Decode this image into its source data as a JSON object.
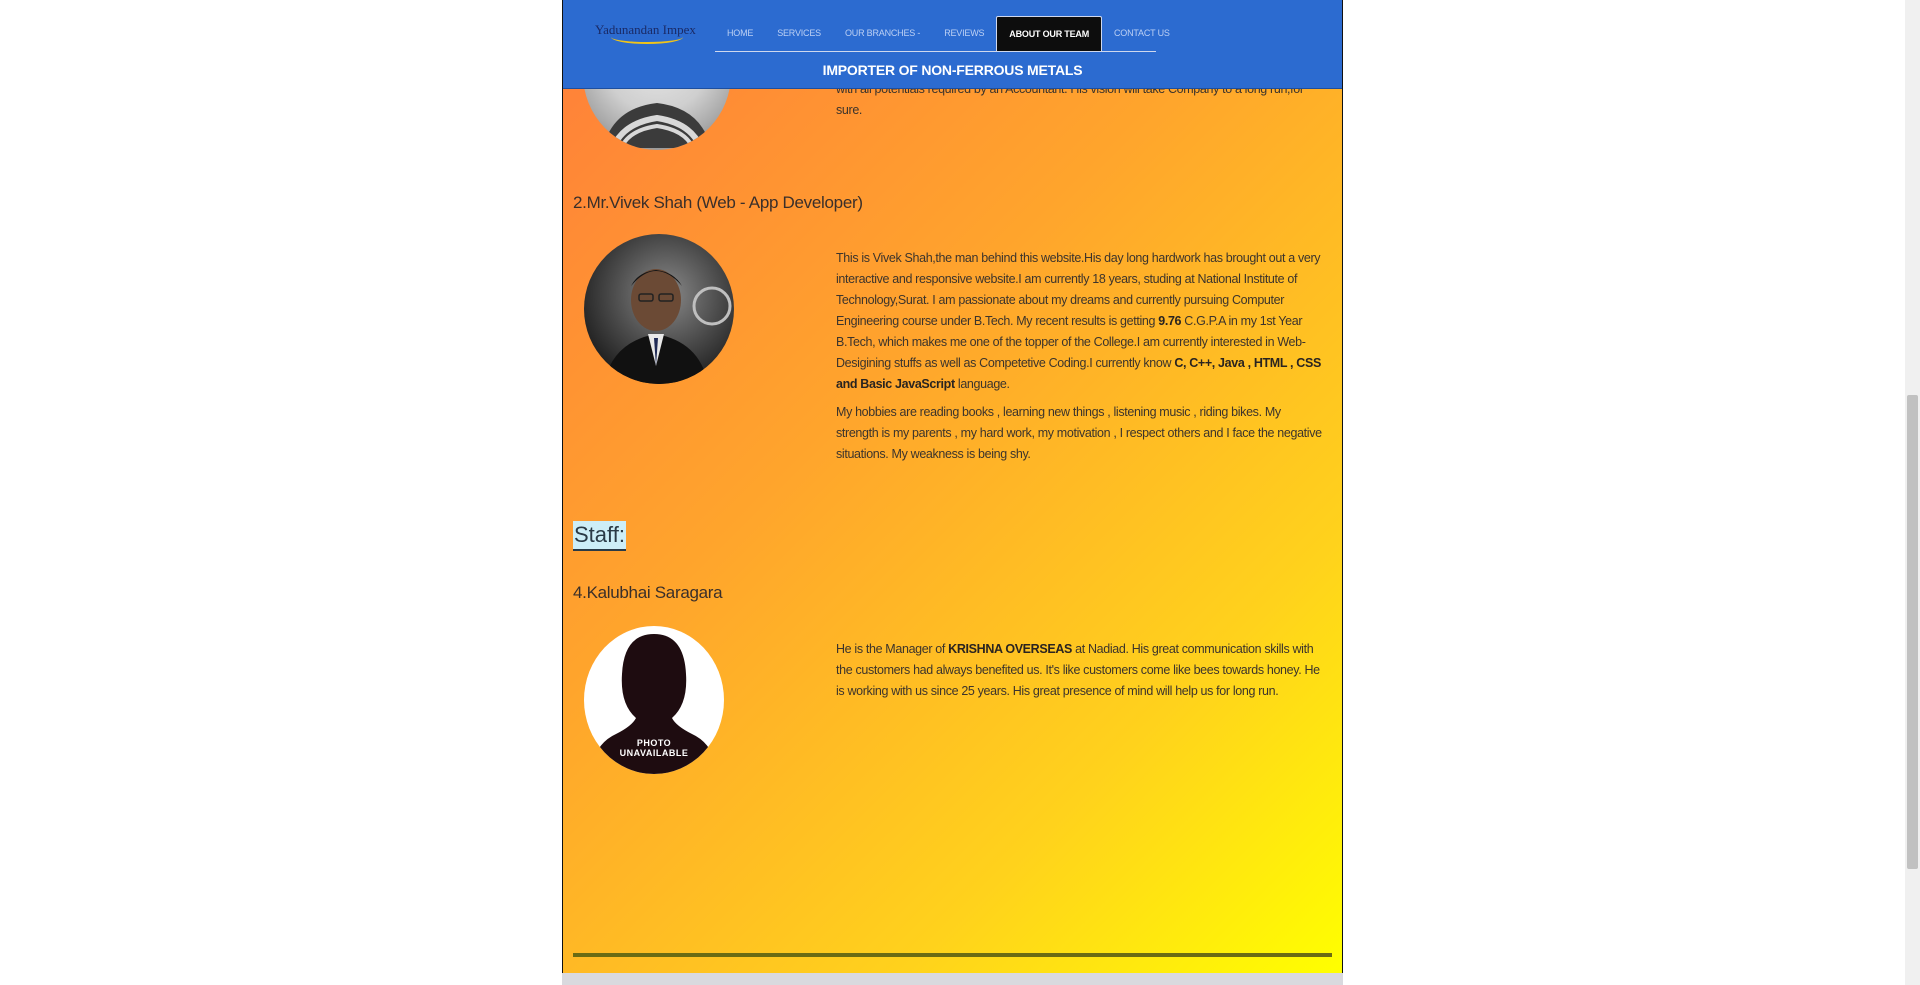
{
  "header": {
    "logo_text": "Yadunandan Impex",
    "nav": [
      {
        "label": "HOME"
      },
      {
        "label": "SERVICES"
      },
      {
        "label": "OUR BRANCHES -"
      },
      {
        "label": "REVIEWS"
      },
      {
        "label": "ABOUT OUR TEAM"
      },
      {
        "label": "CONTACT US"
      }
    ],
    "tagline": "IMPORTER OF NON-FERROUS METALS"
  },
  "member1": {
    "bio_tail": "with all potentials required by an Accountant. His vision will take Company to a long run,for sure."
  },
  "member2": {
    "title": "2.Mr.Vivek Shah (Web - App Developer)",
    "p1_a": "This is Vivek Shah,the man behind this website.His day long hardwork has brought out a very interactive and responsive website.I am currently 18 years, studing at National Institute of Technology,Surat. I am passionate about my dreams and currently pursuing Computer Engineering course under B.Tech. My recent results is getting ",
    "p1_bold1": "9.76",
    "p1_b": " C.G.P.A in my 1st Year B.Tech, which makes me one of the topper of the College.I am currently interested in Web-Desigining stuffs as well as Competetive Coding.I currently know ",
    "p1_bold2": "C, C++, Java , HTML , CSS and Basic JavaScript",
    "p1_c": " language.",
    "p2": "My hobbies are reading books , learning new things , listening music , riding bikes. My strength is my parents , my hard work, my motivation , I respect others and I face the negative situations. My weakness is being shy."
  },
  "staff": {
    "heading": "Staff:",
    "member4": {
      "title": "4.Kalubhai Saragara",
      "photo_text_1": "PHOTO",
      "photo_text_2": "UNAVAILABLE",
      "p_a": "He is the Manager of ",
      "p_bold": "KRISHNA OVERSEAS",
      "p_b": " at Nadiad. His great communication skills with the customers had always benefited us. It's like customers come like bees towards honey. He is working with us since 25 years. His great presence of mind will help us for long run."
    }
  }
}
